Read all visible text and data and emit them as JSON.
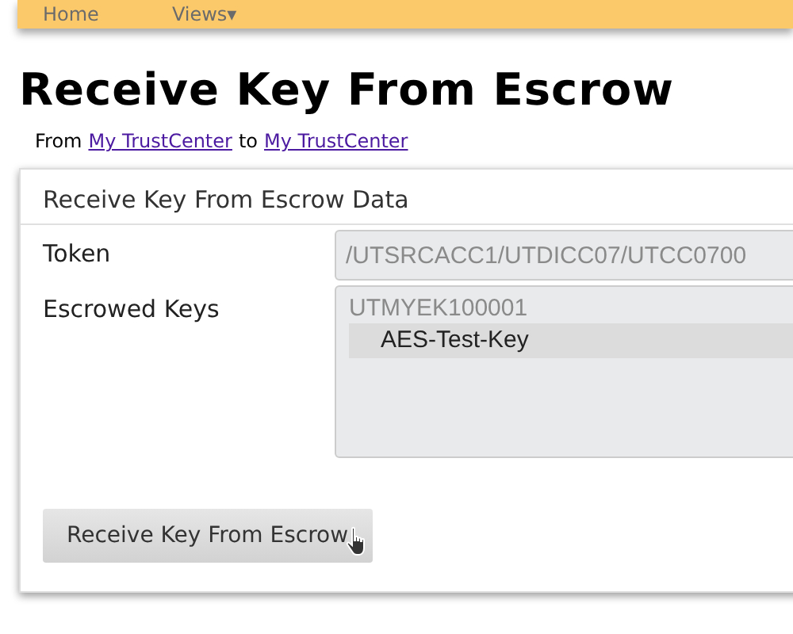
{
  "nav": {
    "items": [
      {
        "label": "Home"
      },
      {
        "label": "Views",
        "caret": "▾"
      }
    ]
  },
  "heading": "Receive Key From Escrow",
  "route": {
    "from_label": "From",
    "from": "My TrustCenter",
    "to_label": "to",
    "to": "My TrustCenter"
  },
  "panel": {
    "title": "Receive Key From Escrow Data",
    "token": {
      "label": "Token",
      "value": "/UTSRCACC1/UTDICC07/UTCC0700",
      "disabled": true
    },
    "keys": {
      "label": "Escrowed Keys",
      "groups": [
        {
          "label": "UTMYEK100001",
          "options": [
            {
              "label": "AES-Test-Key",
              "selected": true
            }
          ]
        }
      ]
    },
    "button": "Receive Key From Escrow"
  }
}
